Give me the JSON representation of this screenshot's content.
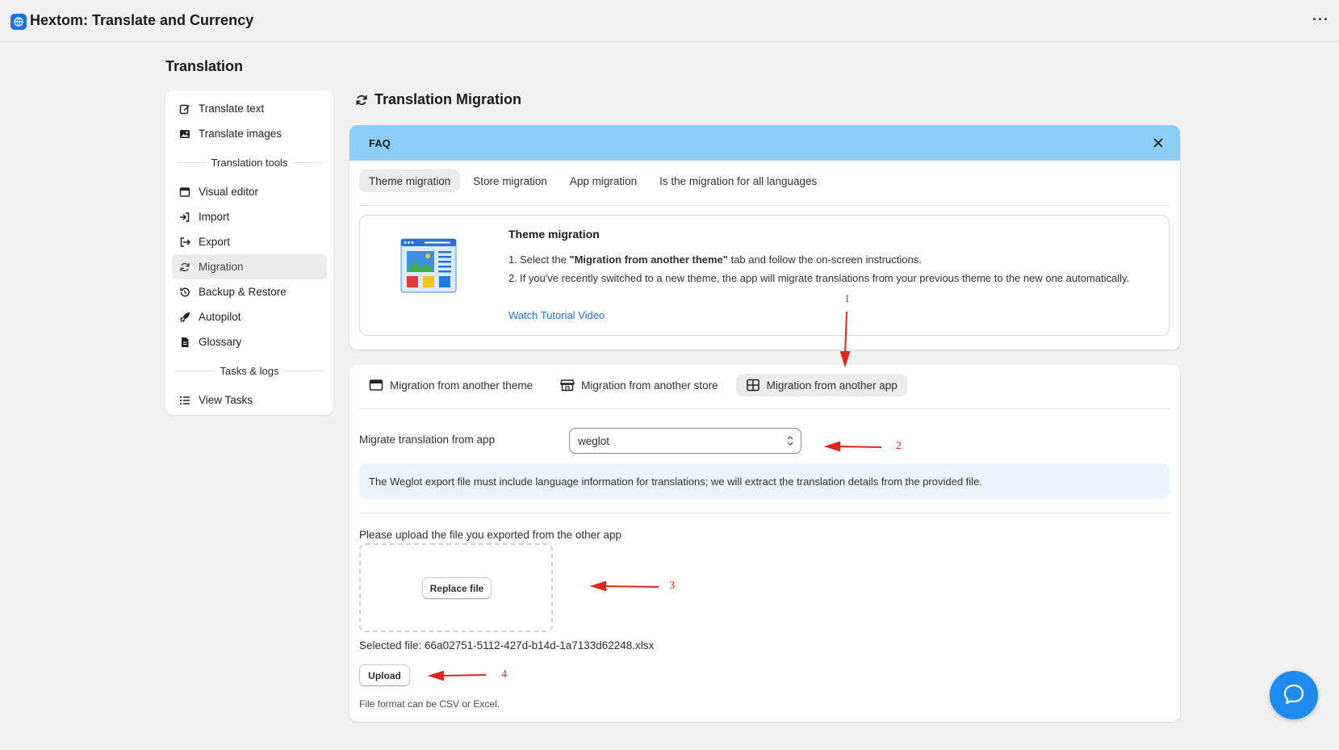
{
  "app": {
    "title": "Hextom: Translate and Currency",
    "more_label": "···"
  },
  "page": {
    "title": "Translation"
  },
  "sidebar": {
    "items": [
      {
        "label": "Translate text",
        "icon": "edit-icon"
      },
      {
        "label": "Translate images",
        "icon": "image-icon"
      },
      {
        "label": "Translation tools",
        "divider": true
      },
      {
        "label": "Visual editor",
        "icon": "window-icon"
      },
      {
        "label": "Import",
        "icon": "import-icon"
      },
      {
        "label": "Export",
        "icon": "export-icon"
      },
      {
        "label": "Migration",
        "icon": "refresh-icon",
        "active": true
      },
      {
        "label": "Backup & Restore",
        "icon": "history-icon"
      },
      {
        "label": "Autopilot",
        "icon": "rocket-icon"
      },
      {
        "label": "Glossary",
        "icon": "document-icon"
      },
      {
        "label": "Tasks & logs",
        "divider": true
      },
      {
        "label": "View Tasks",
        "icon": "list-icon"
      }
    ]
  },
  "section": {
    "title": "Translation Migration"
  },
  "faq": {
    "header": "FAQ",
    "tabs": [
      "Theme migration",
      "Store migration",
      "App migration",
      "Is the migration for all languages"
    ],
    "active_tab": 0,
    "heading": "Theme migration",
    "step1_prefix": "Select the ",
    "step1_bold": "\"Migration from another theme\"",
    "step1_suffix": " tab and follow the on-screen instructions.",
    "step2": "If you've recently switched to a new theme, the app will migrate translations from your previous theme to the new one automatically.",
    "num1": "1.",
    "num2": "2.",
    "link": "Watch Tutorial Video"
  },
  "migration": {
    "tabs": [
      "Migration from another theme",
      "Migration from another store",
      "Migration from another app"
    ],
    "active_tab": 2,
    "from_app_label": "Migrate translation from app",
    "from_app_value": "weglot",
    "banner": "The Weglot export file must include language information for translations; we will extract the translation details from the provided file.",
    "upload_label": "Please upload the file you exported from the other app",
    "replace_button": "Replace file",
    "selected_file": "Selected file: 66a02751-5112-427d-b14d-1a7133d62248.xlsx",
    "upload_button": "Upload",
    "hint": "File format can be CSV or Excel."
  },
  "annotations": [
    "1",
    "2",
    "3",
    "4"
  ],
  "colors": {
    "accent": "#1773e6",
    "faq_header": "#8ccdfa",
    "banner": "#eaf4ff",
    "annotation": "#e0261d",
    "help_button": "#1d8bf0"
  }
}
